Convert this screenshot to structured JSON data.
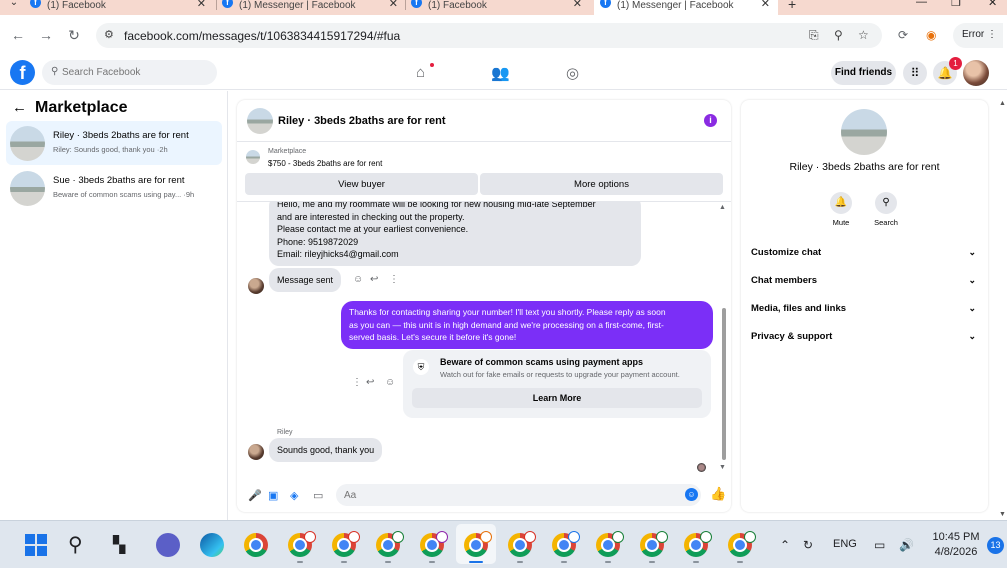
{
  "browser": {
    "tabs": [
      {
        "title": "(1) Facebook",
        "active": false
      },
      {
        "title": "(1) Messenger | Facebook",
        "active": false
      },
      {
        "title": "(1) Facebook",
        "active": false
      },
      {
        "title": "(1) Messenger | Facebook",
        "active": true
      }
    ],
    "url": "facebook.com/messages/t/1063834415917294/#fua",
    "error_label": "Error",
    "icons": [
      "back-icon",
      "forward-icon",
      "reload-icon",
      "install-icon",
      "zoom-icon",
      "star-icon",
      "extension-icon",
      "profile-icon"
    ]
  },
  "facebook": {
    "logo": "f",
    "search_placeholder": "Search Facebook",
    "find_friends_label": "Find friends",
    "notification_count": "1"
  },
  "left": {
    "title": "Marketplace",
    "conversations": [
      {
        "title": "Riley · 3beds 2baths are for rent",
        "subtitle": "Riley: Sounds good, thank you ·2h",
        "selected": true
      },
      {
        "title": "Sue · 3beds 2baths are for rent",
        "subtitle": "Beware of common scams using pay... ·9h",
        "selected": false
      }
    ]
  },
  "chat": {
    "title": "Riley · 3beds 2baths are for rent",
    "marketplace_label": "Marketplace",
    "listing": "$750 - 3beds 2baths are for rent",
    "view_buyer_label": "View buyer",
    "more_options_label": "More options",
    "incoming_lines": [
      "Hello, me and my roommate will be looking for new housing mid-late September",
      "and are interested in checking out the property.",
      "Please contact me at your earliest convenience.",
      "Phone: 9519872029",
      "Email: rileyjhicks4@gmail.com"
    ],
    "message_sent": "Message sent",
    "outgoing_lines": [
      "Thanks for contacting sharing your number! I'll text you shortly. Please reply as soon",
      "as you can — this unit is in high demand and we're processing on a first-come, first-",
      "served basis. Let's secure it before it's gone!"
    ],
    "scam_title": "Beware of common scams using payment apps",
    "scam_subtitle": "Watch out for fake emails or requests to upgrade your payment account.",
    "learn_more_label": "Learn More",
    "sender_name": "Riley",
    "reply_text": "Sounds good, thank you",
    "composer_placeholder": "Aa",
    "accent_color": "#7b2ff7"
  },
  "right": {
    "title": "Riley · 3beds 2baths are for rent",
    "actions": [
      {
        "label": "Mute",
        "icon": "bell-icon"
      },
      {
        "label": "Search",
        "icon": "search-icon"
      }
    ],
    "sections": [
      "Customize chat",
      "Chat members",
      "Media, files and links",
      "Privacy & support"
    ]
  },
  "taskbar": {
    "language": "ENG",
    "time": "10:45 PM",
    "date": "4/8/2026",
    "notification_count": "13"
  }
}
